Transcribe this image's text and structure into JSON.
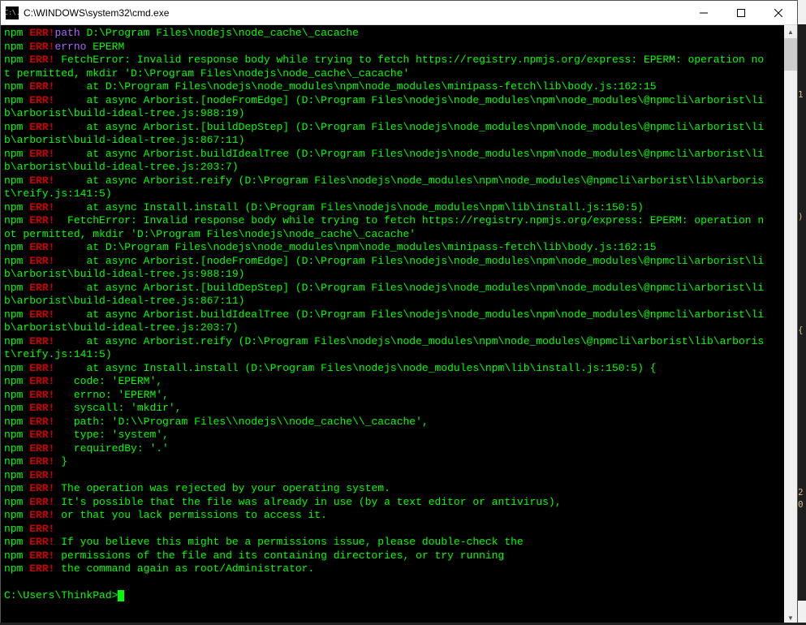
{
  "window": {
    "title": "C:\\WINDOWS\\system32\\cmd.exe",
    "icon_label": "C:\\."
  },
  "terminal": {
    "prompt": "C:\\Users\\ThinkPad>",
    "lines": [
      {
        "prefix": "npm",
        "tag": "ERR!",
        "body": [
          {
            "t": "path",
            "c": "path-key"
          },
          {
            "t": " D:\\Program Files\\nodejs\\node_cache\\_cacache",
            "c": "g"
          }
        ]
      },
      {
        "prefix": "npm",
        "tag": "ERR!",
        "body": [
          {
            "t": "errno",
            "c": "errno-key"
          },
          {
            "t": " EPERM",
            "c": "g"
          }
        ]
      },
      {
        "prefix": "npm",
        "tag": "ERR!",
        "body": [
          {
            "t": " FetchError: Invalid response body while trying to fetch https://registry.npmjs.org/express: EPERM: operation no",
            "c": "g"
          }
        ]
      },
      {
        "cont": true,
        "body": [
          {
            "t": "t permitted, mkdir 'D:\\Program Files\\nodejs\\node_cache\\_cacache'",
            "c": "g"
          }
        ]
      },
      {
        "prefix": "npm",
        "tag": "ERR!",
        "body": [
          {
            "t": "     at D:\\Program Files\\nodejs\\node_modules\\npm\\node_modules\\minipass-fetch\\lib\\body.js:162:15",
            "c": "g"
          }
        ]
      },
      {
        "prefix": "npm",
        "tag": "ERR!",
        "body": [
          {
            "t": "     at async Arborist.[nodeFromEdge] (D:\\Program Files\\nodejs\\node_modules\\npm\\node_modules\\@npmcli\\arborist\\li",
            "c": "g"
          }
        ]
      },
      {
        "cont": true,
        "body": [
          {
            "t": "b\\arborist\\build-ideal-tree.js:988:19)",
            "c": "g"
          }
        ]
      },
      {
        "prefix": "npm",
        "tag": "ERR!",
        "body": [
          {
            "t": "     at async Arborist.[buildDepStep] (D:\\Program Files\\nodejs\\node_modules\\npm\\node_modules\\@npmcli\\arborist\\li",
            "c": "g"
          }
        ]
      },
      {
        "cont": true,
        "body": [
          {
            "t": "b\\arborist\\build-ideal-tree.js:867:11)",
            "c": "g"
          }
        ]
      },
      {
        "prefix": "npm",
        "tag": "ERR!",
        "body": [
          {
            "t": "     at async Arborist.buildIdealTree (D:\\Program Files\\nodejs\\node_modules\\npm\\node_modules\\@npmcli\\arborist\\li",
            "c": "g"
          }
        ]
      },
      {
        "cont": true,
        "body": [
          {
            "t": "b\\arborist\\build-ideal-tree.js:203:7)",
            "c": "g"
          }
        ]
      },
      {
        "prefix": "npm",
        "tag": "ERR!",
        "body": [
          {
            "t": "     at async Arborist.reify (D:\\Program Files\\nodejs\\node_modules\\npm\\node_modules\\@npmcli\\arborist\\lib\\arboris",
            "c": "g"
          }
        ]
      },
      {
        "cont": true,
        "body": [
          {
            "t": "t\\reify.js:141:5)",
            "c": "g"
          }
        ]
      },
      {
        "prefix": "npm",
        "tag": "ERR!",
        "body": [
          {
            "t": "     at async Install.install (D:\\Program Files\\nodejs\\node_modules\\npm\\lib\\install.js:150:5)",
            "c": "g"
          }
        ]
      },
      {
        "prefix": "npm",
        "tag": "ERR!",
        "body": [
          {
            "t": "  FetchError: Invalid response body while trying to fetch https://registry.npmjs.org/express: EPERM: operation n",
            "c": "g"
          }
        ]
      },
      {
        "cont": true,
        "body": [
          {
            "t": "ot permitted, mkdir 'D:\\Program Files\\nodejs\\node_cache\\_cacache'",
            "c": "g"
          }
        ]
      },
      {
        "prefix": "npm",
        "tag": "ERR!",
        "body": [
          {
            "t": "     at D:\\Program Files\\nodejs\\node_modules\\npm\\node_modules\\minipass-fetch\\lib\\body.js:162:15",
            "c": "g"
          }
        ]
      },
      {
        "prefix": "npm",
        "tag": "ERR!",
        "body": [
          {
            "t": "     at async Arborist.[nodeFromEdge] (D:\\Program Files\\nodejs\\node_modules\\npm\\node_modules\\@npmcli\\arborist\\li",
            "c": "g"
          }
        ]
      },
      {
        "cont": true,
        "body": [
          {
            "t": "b\\arborist\\build-ideal-tree.js:988:19)",
            "c": "g"
          }
        ]
      },
      {
        "prefix": "npm",
        "tag": "ERR!",
        "body": [
          {
            "t": "     at async Arborist.[buildDepStep] (D:\\Program Files\\nodejs\\node_modules\\npm\\node_modules\\@npmcli\\arborist\\li",
            "c": "g"
          }
        ]
      },
      {
        "cont": true,
        "body": [
          {
            "t": "b\\arborist\\build-ideal-tree.js:867:11)",
            "c": "g"
          }
        ]
      },
      {
        "prefix": "npm",
        "tag": "ERR!",
        "body": [
          {
            "t": "     at async Arborist.buildIdealTree (D:\\Program Files\\nodejs\\node_modules\\npm\\node_modules\\@npmcli\\arborist\\li",
            "c": "g"
          }
        ]
      },
      {
        "cont": true,
        "body": [
          {
            "t": "b\\arborist\\build-ideal-tree.js:203:7)",
            "c": "g"
          }
        ]
      },
      {
        "prefix": "npm",
        "tag": "ERR!",
        "body": [
          {
            "t": "     at async Arborist.reify (D:\\Program Files\\nodejs\\node_modules\\npm\\node_modules\\@npmcli\\arborist\\lib\\arboris",
            "c": "g"
          }
        ]
      },
      {
        "cont": true,
        "body": [
          {
            "t": "t\\reify.js:141:5)",
            "c": "g"
          }
        ]
      },
      {
        "prefix": "npm",
        "tag": "ERR!",
        "body": [
          {
            "t": "     at async Install.install (D:\\Program Files\\nodejs\\node_modules\\npm\\lib\\install.js:150:5) {",
            "c": "g"
          }
        ]
      },
      {
        "prefix": "npm",
        "tag": "ERR!",
        "body": [
          {
            "t": "   code: 'EPERM',",
            "c": "g"
          }
        ]
      },
      {
        "prefix": "npm",
        "tag": "ERR!",
        "body": [
          {
            "t": "   errno: 'EPERM',",
            "c": "g"
          }
        ]
      },
      {
        "prefix": "npm",
        "tag": "ERR!",
        "body": [
          {
            "t": "   syscall: 'mkdir',",
            "c": "g"
          }
        ]
      },
      {
        "prefix": "npm",
        "tag": "ERR!",
        "body": [
          {
            "t": "   path: 'D:\\\\Program Files\\\\nodejs\\\\node_cache\\\\_cacache',",
            "c": "g"
          }
        ]
      },
      {
        "prefix": "npm",
        "tag": "ERR!",
        "body": [
          {
            "t": "   type: 'system',",
            "c": "g"
          }
        ]
      },
      {
        "prefix": "npm",
        "tag": "ERR!",
        "body": [
          {
            "t": "   requiredBy: '.'",
            "c": "g"
          }
        ]
      },
      {
        "prefix": "npm",
        "tag": "ERR!",
        "body": [
          {
            "t": " }",
            "c": "g"
          }
        ]
      },
      {
        "prefix": "npm",
        "tag": "ERR!",
        "body": []
      },
      {
        "prefix": "npm",
        "tag": "ERR!",
        "body": [
          {
            "t": " The operation was rejected by your operating system.",
            "c": "g"
          }
        ]
      },
      {
        "prefix": "npm",
        "tag": "ERR!",
        "body": [
          {
            "t": " It's possible that the file was already in use (by a text editor or antivirus),",
            "c": "g"
          }
        ]
      },
      {
        "prefix": "npm",
        "tag": "ERR!",
        "body": [
          {
            "t": " or that you lack permissions to access it.",
            "c": "g"
          }
        ]
      },
      {
        "prefix": "npm",
        "tag": "ERR!",
        "body": []
      },
      {
        "prefix": "npm",
        "tag": "ERR!",
        "body": [
          {
            "t": " If you believe this might be a permissions issue, please double-check the",
            "c": "g"
          }
        ]
      },
      {
        "prefix": "npm",
        "tag": "ERR!",
        "body": [
          {
            "t": " permissions of the file and its containing directories, or try running",
            "c": "g"
          }
        ]
      },
      {
        "prefix": "npm",
        "tag": "ERR!",
        "body": [
          {
            "t": " the command again as root/Administrator.",
            "c": "g"
          }
        ]
      }
    ]
  }
}
